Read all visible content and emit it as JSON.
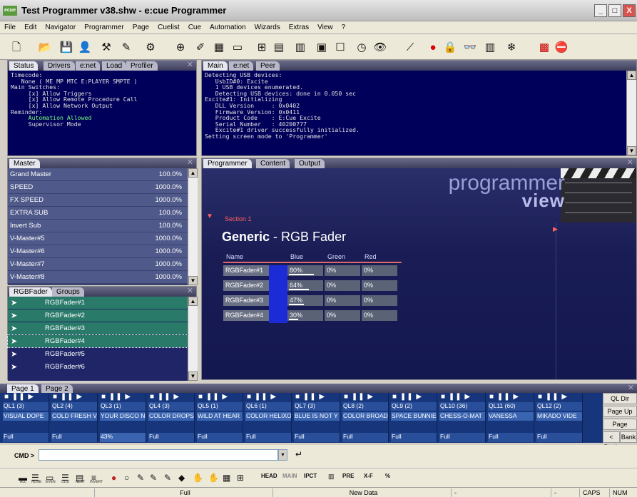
{
  "window": {
    "title": "Test Programmer v38.shw - e:cue Programmer",
    "app_icon": "ecue",
    "min": "_",
    "max": "□",
    "close": "X"
  },
  "menu": [
    "File",
    "Edit",
    "Navigator",
    "Programmer",
    "Page",
    "Cuelist",
    "Cue",
    "Automation",
    "Wizards",
    "Extras",
    "View",
    "?"
  ],
  "status_panel": {
    "tabs": [
      "Status",
      "Drivers",
      "e:net",
      "Load",
      "Profiler"
    ],
    "lines": [
      "Timecode:",
      "   None ( ME MP MTC E:PLAYER SMPTE )",
      "Main Switches:",
      "     [x] Allow Triggers",
      "     [x] Allow Remote Procedure Call",
      "     [x] Allow Network Output",
      "Reminder:",
      "     Automation Allowed",
      "     Supervisor Mode"
    ]
  },
  "main_panel": {
    "tabs": [
      "Main",
      "e:net",
      "Peer"
    ],
    "lines": [
      "Detecting USB devices:",
      "   UsbID#0: Excite",
      "   1 USB devices enumerated.",
      "   Detecting USB devices: done in 0.050 sec",
      "Excite#1: Initializing",
      "   DLL Version     : 0x0402",
      "   Firmware Version: 0x0411",
      "   Product Code    : E:Cue Excite",
      "   Serial Number   : 40200777",
      "   Excite#1 driver successfully initialized.",
      "Setting screen mode to 'Programmer'"
    ]
  },
  "master_panel": {
    "tabs": [
      "Master"
    ],
    "rows": [
      {
        "name": "Grand Master",
        "value": "100.0%"
      },
      {
        "name": "SPEED",
        "value": "1000.0%"
      },
      {
        "name": "FX SPEED",
        "value": "1000.0%"
      },
      {
        "name": "EXTRA SUB",
        "value": "100.0%"
      },
      {
        "name": "Invert Sub",
        "value": "100.0%"
      },
      {
        "name": "V-Master#5",
        "value": "1000.0%"
      },
      {
        "name": "V-Master#6",
        "value": "1000.0%"
      },
      {
        "name": "V-Master#7",
        "value": "1000.0%"
      },
      {
        "name": "V-Master#8",
        "value": "1000.0%"
      }
    ]
  },
  "fader_panel": {
    "tabs": [
      "RGBFader",
      "Groups"
    ],
    "rows": [
      {
        "name": "RGBFader#1",
        "selected": true
      },
      {
        "name": "RGBFader#2",
        "selected": true
      },
      {
        "name": "RGBFader#3",
        "selected": true
      },
      {
        "name": "RGBFader#4",
        "selected": true
      },
      {
        "name": "RGBFader#5",
        "selected": false
      },
      {
        "name": "RGBFader#6",
        "selected": false
      }
    ]
  },
  "programmer": {
    "tabs": [
      "Programmer",
      "Content",
      "Output"
    ],
    "logo_line1": "programmer",
    "logo_line2": "view",
    "section": "Section 1",
    "title_bold": "Generic",
    "title_rest": " - RGB Fader",
    "columns": [
      "Name",
      "Blue",
      "Green",
      "Red"
    ],
    "rows": [
      {
        "name": "RGBFader#1",
        "blue": "80%",
        "green": "0%",
        "red": "0%",
        "blue_level": 0.8
      },
      {
        "name": "RGBFader#2",
        "blue": "64%",
        "green": "0%",
        "red": "0%",
        "blue_level": 0.64
      },
      {
        "name": "RGBFader#3",
        "blue": "47%",
        "green": "0%",
        "red": "0%",
        "blue_level": 0.47
      },
      {
        "name": "RGBFader#4",
        "blue": "30%",
        "green": "0%",
        "red": "0%",
        "blue_level": 0.3
      }
    ]
  },
  "pages": {
    "tabs": [
      "Page 1",
      "Page 2"
    ],
    "cuelists": [
      {
        "ql": "QL1 (3)",
        "name": "VISUAL DOPE",
        "level": "Full"
      },
      {
        "ql": "QL2 (4)",
        "name": "COLD FRESH VI",
        "level": "Full"
      },
      {
        "ql": "QL3 (1)",
        "name": "YOUR DISCO N",
        "level": "43%"
      },
      {
        "ql": "QL4 (3)",
        "name": "COLOR DROPS",
        "level": "Full"
      },
      {
        "ql": "QL5 (1)",
        "name": "WILD AT HEAR",
        "level": "Full"
      },
      {
        "ql": "QL6 (1)",
        "name": "COLOR HELIXO",
        "level": "Full"
      },
      {
        "ql": "QL7 (3)",
        "name": "BLUE IS NOT Y",
        "level": "Full"
      },
      {
        "ql": "QL8 (2)",
        "name": "COLOR BROAD",
        "level": "Full"
      },
      {
        "ql": "QL9 (2)",
        "name": "SPACE BUNNIE",
        "level": "Full"
      },
      {
        "ql": "QL10 (36)",
        "name": "CHESS-O-MAT",
        "level": "Full"
      },
      {
        "ql": "QL11 (60)",
        "name": "VANESSA",
        "level": "Full"
      },
      {
        "ql": "QL12 (2)",
        "name": "MIKADO VIDE",
        "level": "Full"
      }
    ],
    "side_buttons": [
      "QL Dir",
      "Page Up",
      "Page Down",
      "< Bank",
      "Bank >"
    ],
    "ctrl_glyphs": "■ ❚❚ ▶"
  },
  "cmd": {
    "label": "CMD >",
    "value": "",
    "enter_icon": "↵",
    "dropdown_icon": "▾"
  },
  "bottom_toolbar": {
    "small_labels": [
      "ALL",
      "NONE",
      "EVEN",
      "ODD",
      "NEXT",
      "INVERT"
    ],
    "text_buttons": [
      "HEAD",
      "MAIN",
      "IPCT",
      "PRE",
      "X-F",
      "%"
    ]
  },
  "status_bar": {
    "left": "Full",
    "center": "New Data",
    "dash1": "-",
    "dash2": "-",
    "caps": "CAPS",
    "num": "NUM"
  },
  "colors": {
    "dark_panel": "#00005a",
    "accent_green": "#2a7a6a",
    "cue_blue": "#16357a",
    "red_accent": "#ff6060"
  }
}
